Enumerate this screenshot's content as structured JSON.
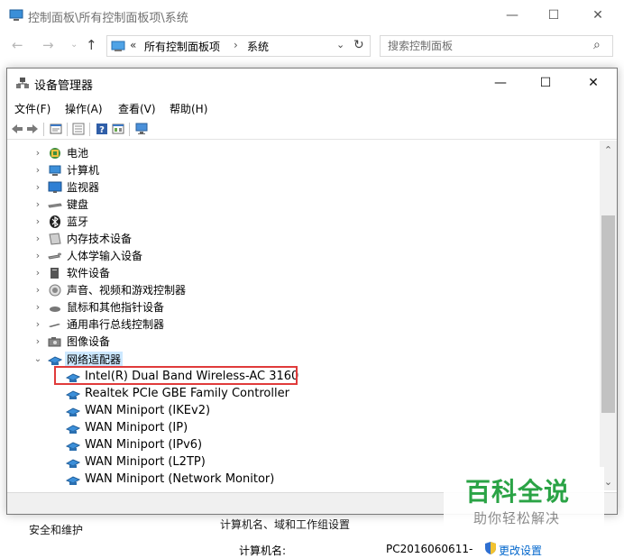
{
  "control_panel": {
    "title": "控制面板\\所有控制面板项\\系统",
    "nav": {
      "back": "←",
      "forward": "→",
      "recent": "⌄",
      "up": "↑"
    },
    "address": {
      "chevron": "«",
      "segment1": "所有控制面板项",
      "separator": "›",
      "segment2": "系统",
      "dropdown": "⌄",
      "refresh": "↻"
    },
    "search": {
      "placeholder": "搜索控制面板"
    },
    "bottom": {
      "side_link": "安全和维护",
      "section_title": "计算机名、域和工作组设置",
      "computer_name_label": "计算机名:",
      "computer_name_value": "PC2016060611-",
      "change_settings": "更改设置"
    }
  },
  "device_manager": {
    "title": "设备管理器",
    "menu": [
      "文件(F)",
      "操作(A)",
      "查看(V)",
      "帮助(H)"
    ],
    "tree": {
      "categories": [
        {
          "label": "电池",
          "icon": "battery-icon"
        },
        {
          "label": "计算机",
          "icon": "computer-icon"
        },
        {
          "label": "监视器",
          "icon": "monitor-icon"
        },
        {
          "label": "键盘",
          "icon": "keyboard-icon"
        },
        {
          "label": "蓝牙",
          "icon": "bluetooth-icon"
        },
        {
          "label": "内存技术设备",
          "icon": "memory-icon"
        },
        {
          "label": "人体学输入设备",
          "icon": "hid-icon"
        },
        {
          "label": "软件设备",
          "icon": "software-device-icon"
        },
        {
          "label": "声音、视频和游戏控制器",
          "icon": "sound-icon"
        },
        {
          "label": "鼠标和其他指针设备",
          "icon": "mouse-icon"
        },
        {
          "label": "通用串行总线控制器",
          "icon": "usb-icon"
        },
        {
          "label": "图像设备",
          "icon": "camera-icon"
        }
      ],
      "expanded_category": {
        "label": "网络适配器",
        "icon": "network-adapter-icon"
      },
      "network_devices": [
        "Intel(R) Dual Band Wireless-AC 3160",
        "Realtek PCIe GBE Family Controller",
        "WAN Miniport (IKEv2)",
        "WAN Miniport (IP)",
        "WAN Miniport (IPv6)",
        "WAN Miniport (L2TP)",
        "WAN Miniport (Network Monitor)"
      ],
      "highlighted_device_index": 0
    }
  },
  "watermark": {
    "title": "百科全说",
    "subtitle": "助你轻松解决"
  },
  "colors": {
    "highlight_border": "#e03b3b",
    "selection_bg": "#cce8ff",
    "watermark_green": "#2aa345",
    "link_blue": "#0066cc"
  }
}
